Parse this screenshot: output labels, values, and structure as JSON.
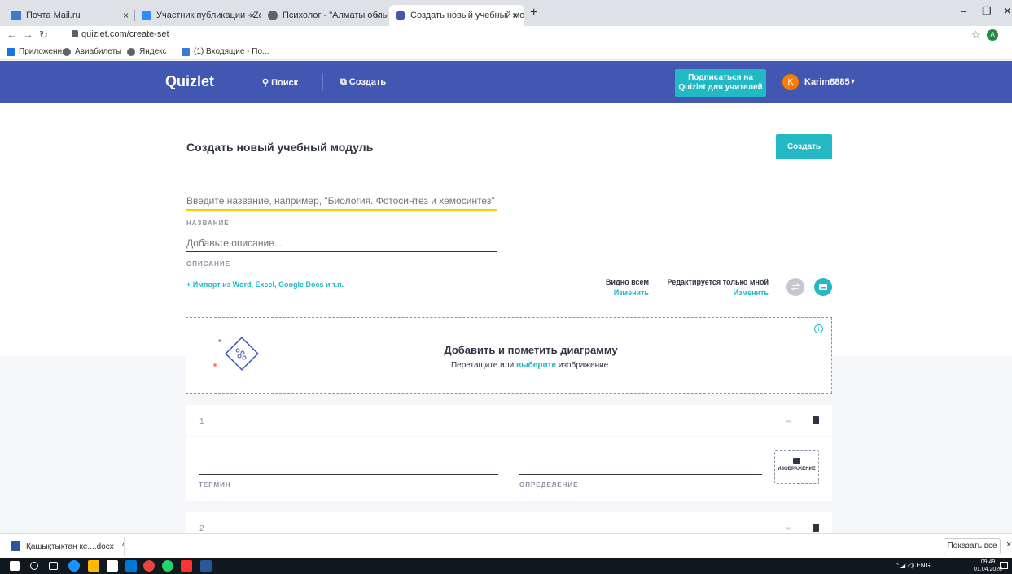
{
  "browser": {
    "tabs": [
      {
        "label": "Почта Mail.ru",
        "favicon_color": "#3b7bd4"
      },
      {
        "label": "Участник публикации - Zoom",
        "favicon_color": "#2d8cff"
      },
      {
        "label": "Психолог - \"Алматы облыстық ...",
        "favicon_color": "#5f6368"
      },
      {
        "label": "Создать новый учебный моду...",
        "favicon_color": "#4257b2"
      }
    ],
    "close_glyph": "×",
    "new_tab": "+",
    "url": "quizlet.com/create-set",
    "profile_initial": "A",
    "bookmarks": [
      "Приложения",
      "Авиабилеты",
      "Яндекс",
      "(1) Входящие - По..."
    ]
  },
  "header": {
    "logo": "Quizlet",
    "search_label": "Поиск",
    "create_label": "Создать",
    "teachers_line1": "Подписаться на",
    "teachers_line2": "Quizlet для учителей",
    "avatar_initial": "K",
    "username": "Karim8885"
  },
  "form": {
    "page_title": "Создать новый учебный модуль",
    "create_button": "Создать",
    "title_placeholder": "Введите название, например, \"Биология. Фотосинтез и хемосинтез\"",
    "title_label": "НАЗВАНИЕ",
    "desc_placeholder": "Добавьте описание...",
    "desc_label": "ОПИСАНИЕ",
    "import_link": "+ Импорт из Word, Excel, Google Docs и т.п.",
    "visibility_title": "Видно всем",
    "visibility_change": "Изменить",
    "edit_title": "Редактируется только мной",
    "edit_change": "Изменить"
  },
  "diagram": {
    "title": "Добавить и пометить диаграмму",
    "sub_before": "Перетащите или ",
    "sub_link": "выберите",
    "sub_after": " изображение.",
    "info": "i"
  },
  "cards": [
    {
      "number": "1",
      "term_label": "ТЕРМИН",
      "definition_label": "ОПРЕДЕЛЕНИЕ",
      "image_label": "ИЗОБРАЖЕНИЕ"
    },
    {
      "number": "2"
    }
  ],
  "downloads": {
    "file": "Қашықтықтан ке....docx",
    "show_all": "Показать все",
    "close": "×"
  },
  "taskbar": {
    "tray": "ENG",
    "time": "09:49",
    "date": "01.04.2020"
  },
  "colors": {
    "brand": "#4257b2",
    "accent": "#23b9c4",
    "title_underline": "#ffc900"
  }
}
